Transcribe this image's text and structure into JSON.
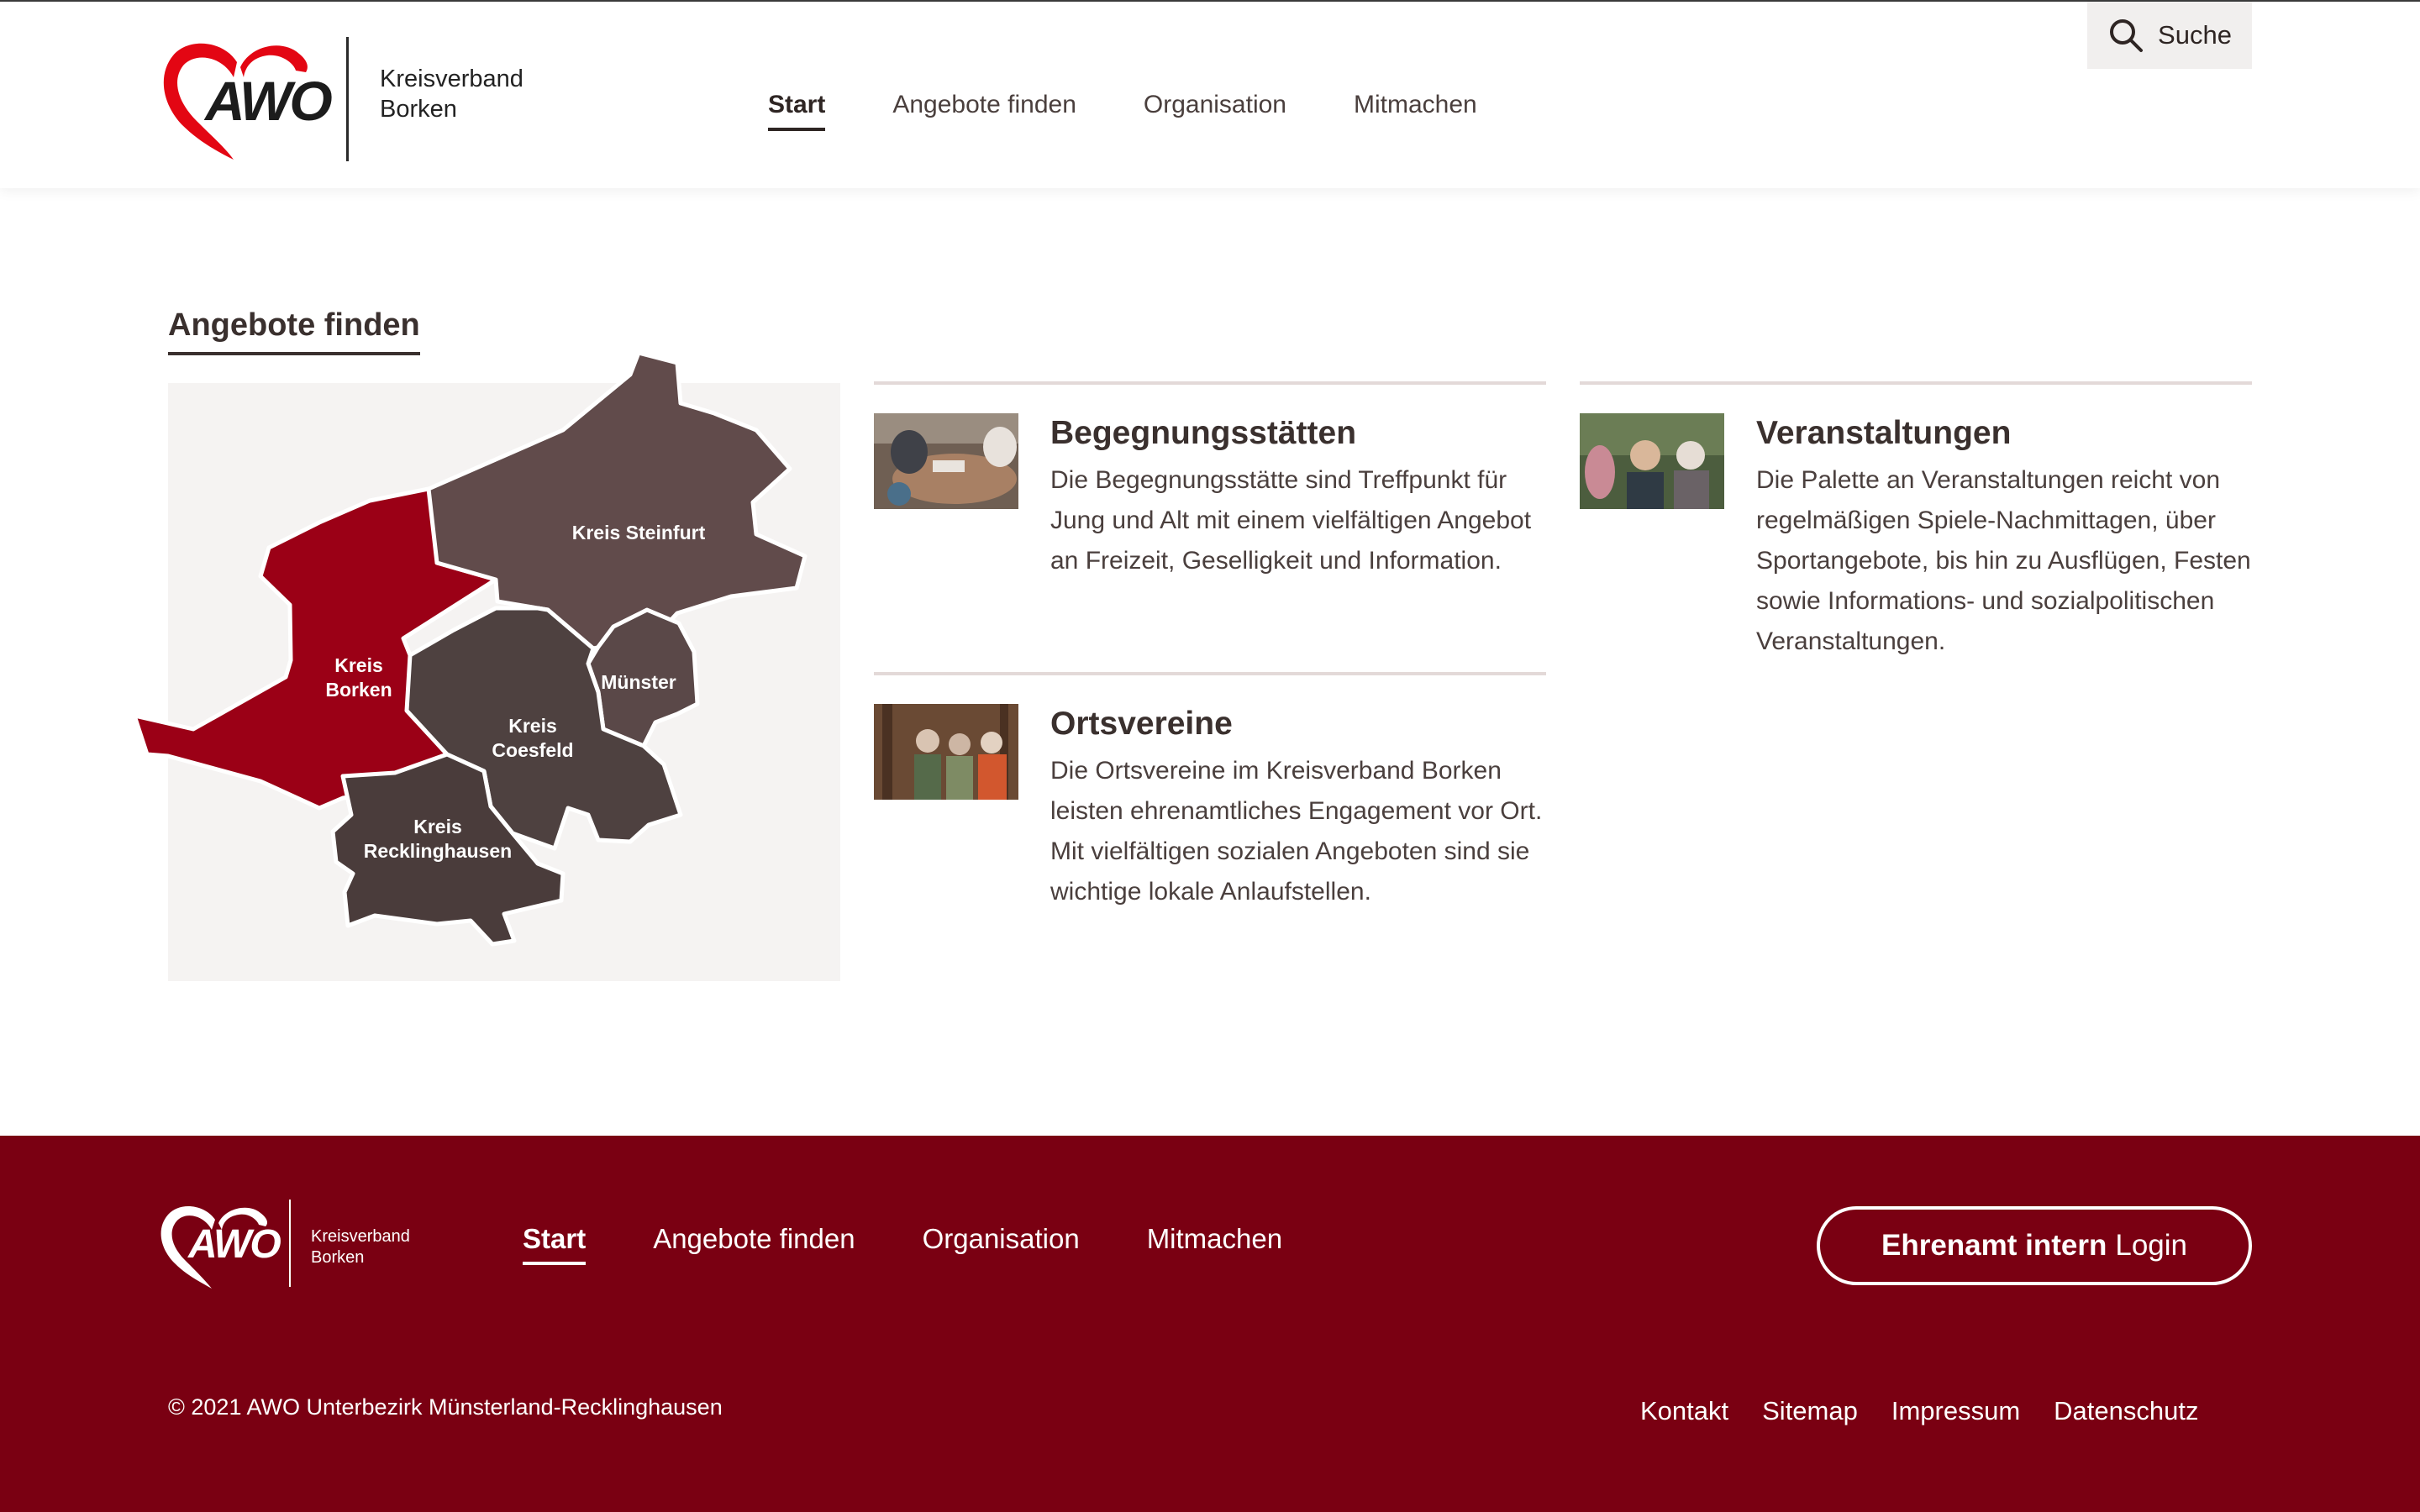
{
  "header": {
    "logo": {
      "brand": "AWO",
      "line1": "Kreisverband",
      "line2": "Borken"
    },
    "nav": [
      {
        "label": "Start",
        "active": true
      },
      {
        "label": "Angebote finden",
        "active": false
      },
      {
        "label": "Organisation",
        "active": false
      },
      {
        "label": "Mitmachen",
        "active": false
      }
    ],
    "search_label": "Suche",
    "search_icon": "magnifier"
  },
  "section": {
    "title": "Angebote finden",
    "map": {
      "regions": [
        {
          "label_line1": "Kreis",
          "label_line2": "Borken",
          "color": "#9b0016"
        },
        {
          "label_line1": "Kreis Steinfurt",
          "label_line2": "",
          "color": "#614b4b"
        },
        {
          "label_line1": "Kreis",
          "label_line2": "Coesfeld",
          "color": "#4e4140"
        },
        {
          "label_line1": "Münster",
          "label_line2": "",
          "color": "#5a4848"
        },
        {
          "label_line1": "Kreis",
          "label_line2": "Recklinghausen",
          "color": "#4a3c3b"
        }
      ]
    },
    "cards": [
      {
        "title": "Begegnungsstätten",
        "text": "Die Begegnungsstätte sind Treffpunkt für Jung und Alt mit einem vielfältigen Angebot an Freizeit, Geselligkeit und Information."
      },
      {
        "title": "Veranstaltungen",
        "text": "Die Palette an Veranstaltungen reicht von regelmäßigen Spiele-Nachmittagen, über Sportangebote, bis hin zu Ausflügen, Festen sowie Informations- und sozialpolitischen Veranstaltungen."
      },
      {
        "title": "Ortsvereine",
        "text": "Die Ortsvereine im Kreisverband Borken leisten ehrenamtliches Engagement vor Ort. Mit vielfältigen sozialen Angeboten sind sie wichtige lokale Anlaufstellen."
      }
    ]
  },
  "footer": {
    "logo": {
      "brand": "AWO",
      "line1": "Kreisverband",
      "line2": "Borken"
    },
    "nav": [
      {
        "label": "Start",
        "active": true
      },
      {
        "label": "Angebote finden",
        "active": false
      },
      {
        "label": "Organisation",
        "active": false
      },
      {
        "label": "Mitmachen",
        "active": false
      }
    ],
    "login": {
      "bold": "Ehrenamt intern",
      "normal": "Login"
    },
    "copyright": "© 2021 AWO Unterbezirk Münsterland-Recklinghausen",
    "legal": [
      "Kontakt",
      "Sitemap",
      "Impressum",
      "Datenschutz"
    ],
    "background": "#7a0012"
  },
  "colors": {
    "brand_red": "#e30613",
    "text_dark": "#3a302e",
    "text": "#4a3f3d"
  }
}
